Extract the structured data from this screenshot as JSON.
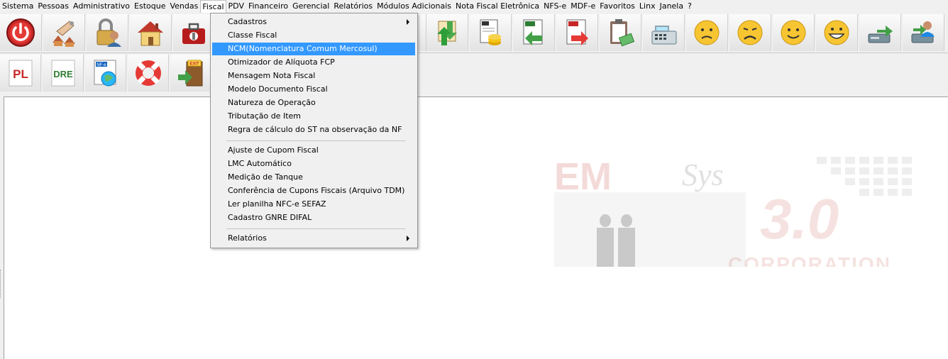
{
  "menubar": {
    "items": [
      "Sistema",
      "Pessoas",
      "Administrativo",
      "Estoque",
      "Vendas",
      "Fiscal",
      "PDV",
      "Financeiro",
      "Gerencial",
      "Relatórios",
      "Módulos Adicionais",
      "Nota Fiscal Eletrônica",
      "NFS-e",
      "MDF-e",
      "Favoritos",
      "Linx",
      "Janela",
      "?"
    ],
    "active": "Fiscal"
  },
  "toolbar1": {
    "icons": [
      "power-icon",
      "key-hand-icon",
      "lock-user-icon",
      "house-icon",
      "toolbox-icon",
      "swap-icon",
      "ticket-money-icon",
      "nfe-arrow-icon",
      "nfs-arrow-icon",
      "clipboard-money-icon",
      "cash-register-icon",
      "smiley-sad-icon",
      "smiley-frown-icon",
      "smiley-happy-icon",
      "smiley-grin-icon",
      "disk-arrow-icon",
      "user-transfer-icon"
    ]
  },
  "toolbar2": {
    "pl_label": "PL",
    "dre_label": "DRE",
    "nfe_label": "NF-e",
    "exit_label": "EXIT"
  },
  "fiscal_menu": {
    "items": [
      {
        "label": "Cadastros",
        "submenu": true
      },
      {
        "label": "Classe Fiscal"
      },
      {
        "label": "NCM(Nomenclatura Comum Mercosul)",
        "highlighted": true
      },
      {
        "label": "Otimizador de Alíquota FCP"
      },
      {
        "label": "Mensagem Nota Fiscal"
      },
      {
        "label": "Modelo Documento Fiscal"
      },
      {
        "label": "Natureza de Operação"
      },
      {
        "label": "Tributação de Item"
      },
      {
        "label": "Regra de cálculo do ST na observação da NF"
      },
      {
        "label": "Ajuste de Cupom Fiscal"
      },
      {
        "label": "LMC Automático"
      },
      {
        "label": "Medição de Tanque"
      },
      {
        "label": "Conferência de Cupons Fiscais (Arquivo TDM)"
      },
      {
        "label": "Ler planilha NFC-e SEFAZ"
      },
      {
        "label": "Cadastro GNRE DIFAL"
      },
      {
        "label": "Relatórios",
        "submenu": true
      }
    ]
  },
  "watermark": {
    "brand": "EM",
    "brand_script": "Sys",
    "version": "3.0",
    "tagline": "CORPORATION"
  },
  "colors": {
    "highlight": "#3399ff",
    "watermark_red": "#c0392b"
  }
}
